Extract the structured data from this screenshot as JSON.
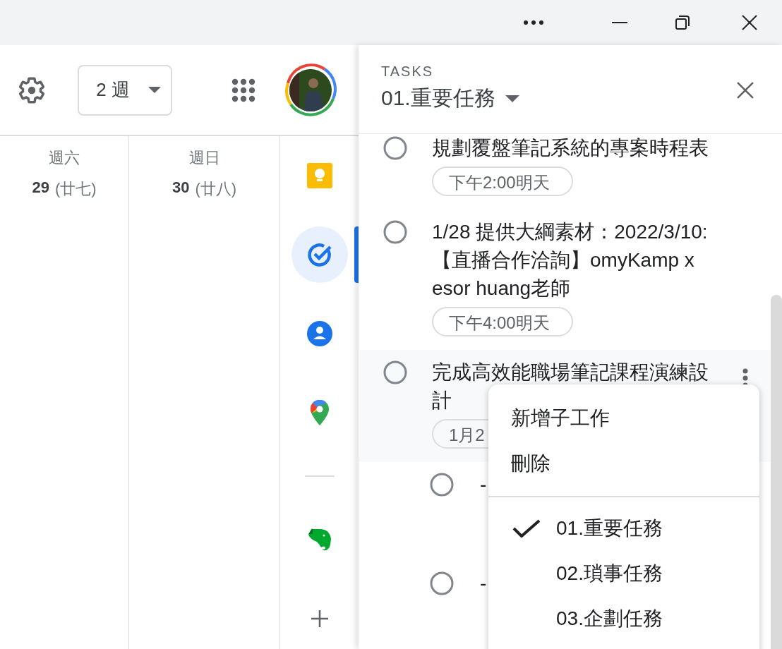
{
  "toolbar": {
    "view_select": {
      "value": "2 週"
    }
  },
  "days": [
    {
      "weekday": "週六",
      "date": "29",
      "lunar": "(廿七)"
    },
    {
      "weekday": "週日",
      "date": "30",
      "lunar": "(廿八)"
    }
  ],
  "side_panel": {
    "items": [
      {
        "kind": "keep",
        "selected": false
      },
      {
        "kind": "tasks",
        "selected": true
      },
      {
        "kind": "contacts",
        "selected": false
      },
      {
        "kind": "maps",
        "selected": false
      },
      {
        "kind": "divider"
      },
      {
        "kind": "evernote",
        "selected": false
      },
      {
        "kind": "add",
        "selected": false
      }
    ]
  },
  "tasks": {
    "heading": "TASKS",
    "list_title": "01.重要任務",
    "items": [
      {
        "title": "規劃覆盤筆記系統的專案時程表",
        "due": "下午2:00明天",
        "completed": false,
        "selected": false
      },
      {
        "title": "1/28 提供大綱素材：2022/3/10:【直播合作洽詢】omyKamp x esor huang老師",
        "due": "下午4:00明天",
        "completed": false,
        "selected": false
      },
      {
        "title": "完成高效能職場筆記課程演練設計",
        "due": "1月2",
        "completed": false,
        "selected": true,
        "children": [
          {
            "title": "-",
            "completed": false
          },
          {
            "title": "-",
            "completed": false
          }
        ]
      }
    ]
  },
  "menu": {
    "actions": [
      "新增子工作",
      "刪除"
    ],
    "lists": [
      {
        "label": "01.重要任務",
        "selected": true
      },
      {
        "label": "02.瑣事任務",
        "selected": false
      },
      {
        "label": "03.企劃任務",
        "selected": false
      }
    ]
  }
}
